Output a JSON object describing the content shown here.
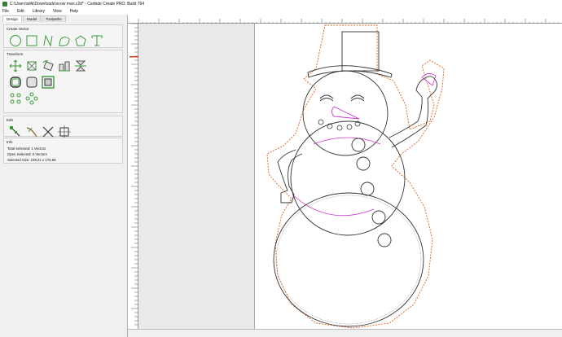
{
  "window": {
    "title": "C:\\Users\\wilk\\Downloads\\snow man.c2d* - Carbide Create PRO: Build 764"
  },
  "menu": {
    "items": [
      "File",
      "Edit",
      "Library",
      "View",
      "Help"
    ]
  },
  "tabs": [
    "Design",
    "Model",
    "Toolpaths"
  ],
  "sections": {
    "create_vector": "Create Vector",
    "transform": "Transform",
    "edit": "Edit",
    "info": "Info"
  },
  "info": {
    "total_selected": "Total Selected:  1 Vectors",
    "open_selected": "Open Selected:  0 Vectors",
    "selected_size": "Selected Size:    109.21 x 176.58"
  },
  "icons": {
    "create": [
      "circle-icon",
      "rectangle-icon",
      "polyline-icon",
      "curve-icon",
      "polygon-icon",
      "text-icon"
    ],
    "transform_row1": [
      "move-icon",
      "scale-icon",
      "rotate-icon",
      "align-icon",
      "mirror-icon"
    ],
    "transform_row2": [
      "offset-icon",
      "fillet-icon",
      "boundary-icon"
    ],
    "transform_row3": [
      "group-icon",
      "join-icon"
    ],
    "edit": [
      "node-edit-icon",
      "trim-icon",
      "cut-icon",
      "box-select-icon"
    ]
  },
  "colors": {
    "tool_green": "#3a9a3a",
    "vector_dark": "#333333",
    "selected_magenta": "#cc33cc",
    "toolpath_orange": "#e0601a",
    "ruler_marker": "#d04010"
  }
}
